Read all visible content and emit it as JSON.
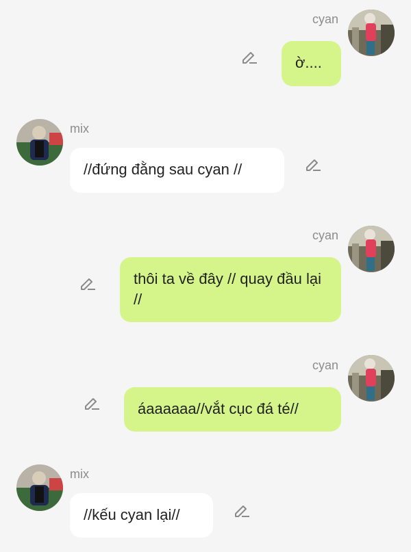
{
  "messages": [
    {
      "sender": "cyan",
      "text": "ờ...."
    },
    {
      "sender": "mix",
      "text": "//đứng đằng sau cyan //"
    },
    {
      "sender": "cyan",
      "text": "thôi ta về đây // quay đầu lại //"
    },
    {
      "sender": "cyan",
      "text": "áaaaaaa//vắt cục đá té//"
    },
    {
      "sender": "mix",
      "text": "//kếu cyan lại//"
    }
  ],
  "icons": {
    "edit": "pencil-edit-icon",
    "avatar_cyan": "avatar-person-pink-shirt",
    "avatar_mix": "avatar-person-dark-jacket"
  },
  "colors": {
    "background": "#f5f5f6",
    "my_bubble": "#d5f58a",
    "other_bubble": "#ffffff",
    "name_text": "#8c8c8c",
    "icon": "#8a8a8a"
  }
}
